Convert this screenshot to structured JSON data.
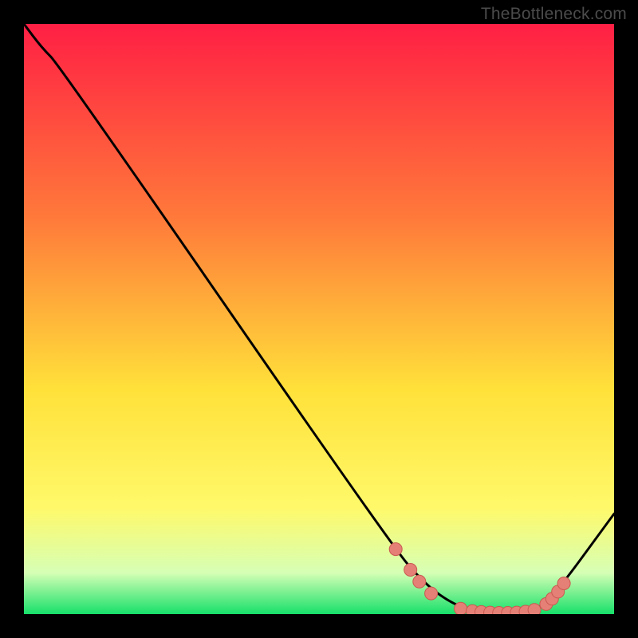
{
  "attribution": "TheBottleneck.com",
  "colors": {
    "gradient_top": "#ff1f44",
    "gradient_mid1": "#ff7a3a",
    "gradient_mid2": "#ffe13a",
    "gradient_mid3": "#fff96a",
    "gradient_mid4": "#d6ffb5",
    "gradient_bot": "#17e06a",
    "line": "#000000",
    "dot_fill": "#e58077",
    "dot_stroke": "#c95a50",
    "background": "#000000"
  },
  "chart_data": {
    "type": "line",
    "title": "",
    "xlabel": "",
    "ylabel": "",
    "xlim": [
      0,
      100
    ],
    "ylim": [
      0,
      100
    ],
    "grid": false,
    "legend": false,
    "series": [
      {
        "name": "curve",
        "x": [
          0,
          3,
          6,
          62,
          68,
          73,
          77,
          80,
          83,
          86,
          89,
          100
        ],
        "y": [
          100,
          96,
          93,
          12,
          5,
          1.5,
          0.4,
          0.2,
          0.2,
          0.6,
          2,
          17
        ]
      }
    ],
    "dots": [
      {
        "x": 63,
        "y": 11
      },
      {
        "x": 65.5,
        "y": 7.5
      },
      {
        "x": 67,
        "y": 5.5
      },
      {
        "x": 69,
        "y": 3.5
      },
      {
        "x": 74,
        "y": 0.9
      },
      {
        "x": 76,
        "y": 0.5
      },
      {
        "x": 77.5,
        "y": 0.35
      },
      {
        "x": 79,
        "y": 0.25
      },
      {
        "x": 80.5,
        "y": 0.2
      },
      {
        "x": 82,
        "y": 0.2
      },
      {
        "x": 83.5,
        "y": 0.25
      },
      {
        "x": 85,
        "y": 0.4
      },
      {
        "x": 86.5,
        "y": 0.7
      },
      {
        "x": 88.5,
        "y": 1.7
      },
      {
        "x": 89.5,
        "y": 2.6
      },
      {
        "x": 90.5,
        "y": 3.8
      },
      {
        "x": 91.5,
        "y": 5.2
      }
    ]
  }
}
